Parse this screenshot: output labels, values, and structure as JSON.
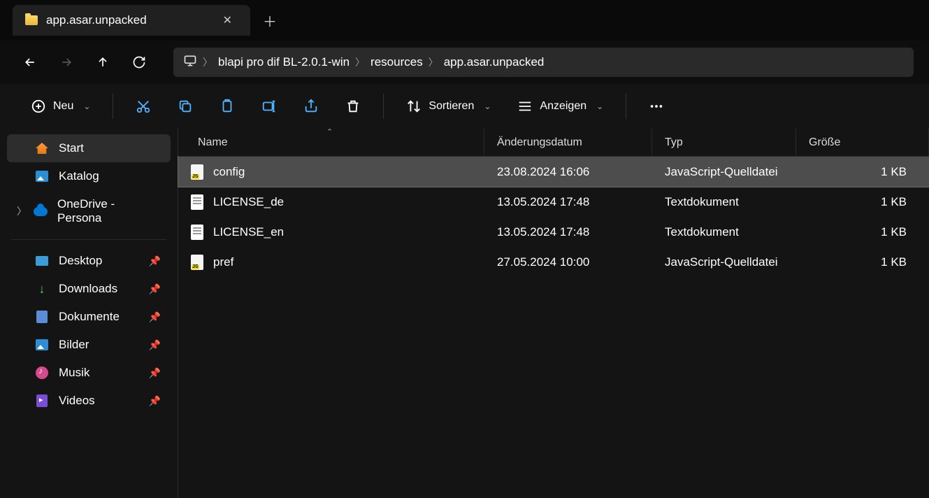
{
  "tab": {
    "title": "app.asar.unpacked"
  },
  "breadcrumbs": [
    "blapi pro dif BL-2.0.1-win",
    "resources",
    "app.asar.unpacked"
  ],
  "toolbar": {
    "new": "Neu",
    "sort": "Sortieren",
    "view": "Anzeigen"
  },
  "columns": {
    "name": "Name",
    "date": "Änderungsdatum",
    "type": "Typ",
    "size": "Größe"
  },
  "sidebar": {
    "top": [
      {
        "label": "Start",
        "icon": "home",
        "selected": true
      },
      {
        "label": "Katalog",
        "icon": "img"
      },
      {
        "label": "OneDrive - Persona",
        "icon": "cloud",
        "expandable": true
      }
    ],
    "pinned": [
      {
        "label": "Desktop",
        "icon": "desktop"
      },
      {
        "label": "Downloads",
        "icon": "dl"
      },
      {
        "label": "Dokumente",
        "icon": "doc"
      },
      {
        "label": "Bilder",
        "icon": "img"
      },
      {
        "label": "Musik",
        "icon": "music"
      },
      {
        "label": "Videos",
        "icon": "video"
      }
    ]
  },
  "files": [
    {
      "name": "config",
      "date": "23.08.2024 16:06",
      "type": "JavaScript-Quelldatei",
      "size": "1 KB",
      "ico": "js",
      "selected": true
    },
    {
      "name": "LICENSE_de",
      "date": "13.05.2024 17:48",
      "type": "Textdokument",
      "size": "1 KB",
      "ico": "txt"
    },
    {
      "name": "LICENSE_en",
      "date": "13.05.2024 17:48",
      "type": "Textdokument",
      "size": "1 KB",
      "ico": "txt"
    },
    {
      "name": "pref",
      "date": "27.05.2024 10:00",
      "type": "JavaScript-Quelldatei",
      "size": "1 KB",
      "ico": "js"
    }
  ]
}
